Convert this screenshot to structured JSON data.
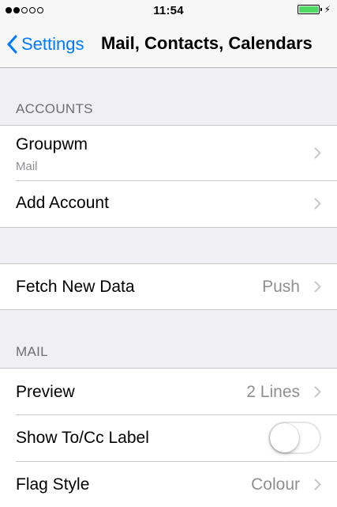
{
  "status_bar": {
    "signal_dots_filled": 2,
    "signal_dots_total": 5,
    "time": "11:54",
    "battery_level": 1.0,
    "battery_color": "#4cd964",
    "charging": true
  },
  "nav": {
    "back_label": "Settings",
    "title": "Mail, Contacts, Calendars",
    "accent_color": "#007aff"
  },
  "accounts": {
    "header": "ACCOUNTS",
    "items": [
      {
        "title": "Groupwm",
        "subtitle": "Mail"
      },
      {
        "title": "Add Account"
      }
    ]
  },
  "fetch": {
    "title": "Fetch New Data",
    "value": "Push"
  },
  "mail": {
    "header": "MAIL",
    "preview": {
      "title": "Preview",
      "value": "2 Lines"
    },
    "show_to_cc": {
      "title": "Show To/Cc Label",
      "enabled": false
    },
    "flag_style": {
      "title": "Flag Style",
      "value": "Colour"
    }
  },
  "icons": {
    "back": "chevron-left-icon",
    "disclosure": "chevron-right-icon",
    "charging": "bolt-icon"
  }
}
